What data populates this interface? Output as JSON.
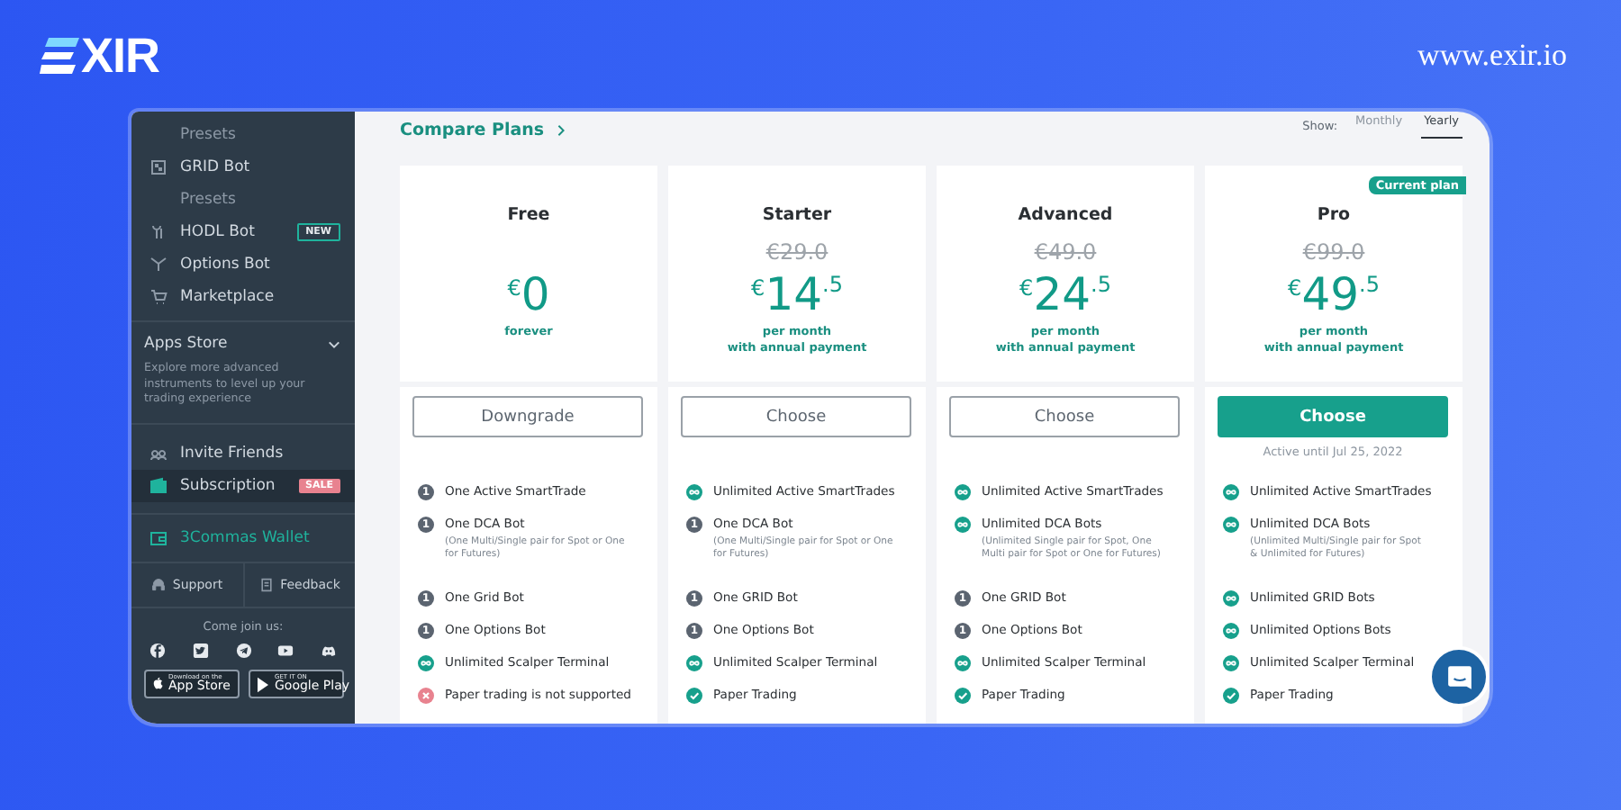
{
  "brand": {
    "logo_text": "XIR",
    "url": "www.exir.io"
  },
  "sidebar": {
    "items": [
      {
        "kind": "sub",
        "label": "Presets"
      },
      {
        "kind": "item",
        "label": "GRID Bot"
      },
      {
        "kind": "sub",
        "label": "Presets"
      },
      {
        "kind": "item",
        "label": "HODL Bot",
        "badge": {
          "text": "NEW",
          "kind": "outline"
        }
      },
      {
        "kind": "item",
        "label": "Options Bot"
      },
      {
        "kind": "item",
        "label": "Marketplace"
      }
    ],
    "apps_store": {
      "title": "Apps Store",
      "description": "Explore more advanced instruments to level up your trading experience"
    },
    "links": [
      {
        "label": "Invite Friends",
        "selected": false
      },
      {
        "label": "Subscription",
        "selected": true,
        "badge": {
          "text": "SALE",
          "kind": "filled"
        }
      }
    ],
    "wallet": "3Commas Wallet",
    "support": "Support",
    "feedback": "Feedback",
    "social_title": "Come join us:",
    "stores": [
      {
        "small": "Download on the",
        "label": "App Store"
      },
      {
        "small": "GET IT ON",
        "label": "Google Play"
      }
    ]
  },
  "compare_link": "Compare Plans",
  "show": {
    "label": "Show:",
    "options": [
      {
        "label": "Monthly",
        "selected": false
      },
      {
        "label": "Yearly",
        "selected": true
      }
    ]
  },
  "plans": [
    {
      "name": "Free",
      "currency": "€",
      "amount": "0",
      "period": [
        "forever"
      ],
      "button": {
        "label": "Downgrade",
        "kind": "outline"
      },
      "features": [
        {
          "kind": "count",
          "marker": "1",
          "text": "One Active SmartTrade"
        },
        {
          "kind": "count",
          "marker": "1",
          "text": "One DCA Bot",
          "note": "(One Multi/Single pair for Spot or One for Futures)"
        },
        {
          "kind": "count",
          "marker": "1",
          "text": "One Grid Bot"
        },
        {
          "kind": "count",
          "marker": "1",
          "text": "One Options Bot"
        },
        {
          "kind": "unlimited",
          "text": "Unlimited Scalper Terminal"
        },
        {
          "kind": "cross",
          "text": "Paper trading is not supported"
        }
      ]
    },
    {
      "name": "Starter",
      "old_price": "€29.0",
      "currency": "€",
      "amount": "14",
      "fraction": ".5",
      "period": [
        "per month",
        "with annual payment"
      ],
      "button": {
        "label": "Choose",
        "kind": "outline"
      },
      "features": [
        {
          "kind": "unlimited",
          "text": "Unlimited Active SmartTrades"
        },
        {
          "kind": "count",
          "marker": "1",
          "text": "One DCA Bot",
          "note": "(One Multi/Single pair for Spot or One for Futures)"
        },
        {
          "kind": "count",
          "marker": "1",
          "text": "One GRID Bot"
        },
        {
          "kind": "count",
          "marker": "1",
          "text": "One Options Bot"
        },
        {
          "kind": "unlimited",
          "text": "Unlimited Scalper Terminal"
        },
        {
          "kind": "check",
          "text": "Paper Trading"
        }
      ]
    },
    {
      "name": "Advanced",
      "old_price": "€49.0",
      "currency": "€",
      "amount": "24",
      "fraction": ".5",
      "period": [
        "per month",
        "with annual payment"
      ],
      "button": {
        "label": "Choose",
        "kind": "outline"
      },
      "features": [
        {
          "kind": "unlimited",
          "text": "Unlimited Active SmartTrades"
        },
        {
          "kind": "unlimited",
          "text": "Unlimited DCA Bots",
          "note": "(Unlimited Single pair for Spot, One Multi pair for Spot or One for Futures)"
        },
        {
          "kind": "count",
          "marker": "1",
          "text": "One GRID Bot"
        },
        {
          "kind": "count",
          "marker": "1",
          "text": "One Options Bot"
        },
        {
          "kind": "unlimited",
          "text": "Unlimited Scalper Terminal"
        },
        {
          "kind": "check",
          "text": "Paper Trading"
        }
      ]
    },
    {
      "name": "Pro",
      "ribbon": "Current plan",
      "old_price": "€99.0",
      "currency": "€",
      "amount": "49",
      "fraction": ".5",
      "period": [
        "per month",
        "with annual payment"
      ],
      "button": {
        "label": "Choose",
        "kind": "primary"
      },
      "active_note": "Active until Jul 25, 2022",
      "features": [
        {
          "kind": "unlimited",
          "text": "Unlimited Active SmartTrades"
        },
        {
          "kind": "unlimited",
          "text": "Unlimited DCA Bots",
          "note": "(Unlimited Multi/Single pair for Spot & Unlimited for Futures)"
        },
        {
          "kind": "unlimited",
          "text": "Unlimited GRID Bots"
        },
        {
          "kind": "unlimited",
          "text": "Unlimited Options Bots"
        },
        {
          "kind": "unlimited",
          "text": "Unlimited Scalper Terminal"
        },
        {
          "kind": "check",
          "text": "Paper Trading"
        }
      ]
    }
  ]
}
